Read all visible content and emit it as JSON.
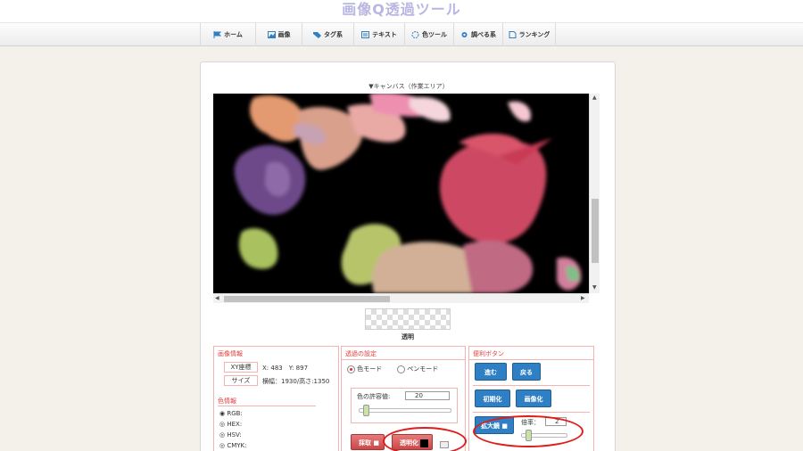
{
  "app": {
    "title": "画像Q透過ツール"
  },
  "nav": [
    {
      "label": "ホーム",
      "icon": "flag-icon"
    },
    {
      "label": "画像",
      "icon": "image-icon"
    },
    {
      "label": "タグ系",
      "icon": "tag-icon"
    },
    {
      "label": "テキスト",
      "icon": "text-icon"
    },
    {
      "label": "色ツール",
      "icon": "palette-icon"
    },
    {
      "label": "調べる系",
      "icon": "gear-icon"
    },
    {
      "label": "ランキング",
      "icon": "document-icon"
    }
  ],
  "canvas": {
    "title": "▼キャンバス（作業エリア）",
    "transparent_label": "透明"
  },
  "image_info": {
    "title": "画像情報",
    "xy_label": "XY座標",
    "xy_value": "X: 483　Y: 897",
    "size_label": "サイズ",
    "size_value": "横幅：1930/高さ:1350"
  },
  "color_info": {
    "title": "色情報",
    "options": [
      "RGB:",
      "HEX:",
      "HSV:",
      "CMYK:"
    ],
    "selected": "RGB:"
  },
  "transparency": {
    "title": "透過の設定",
    "mode_color": "色モード",
    "mode_pen": "ペンモード",
    "tolerance_label": "色の許容値:",
    "tolerance_value": "20",
    "tolerance_level": 0.05,
    "select_button": "採取",
    "transparent_button": "透明化"
  },
  "buttons": {
    "title": "便利ボタン",
    "forward": "進む",
    "back": "戻る",
    "reset": "初期化",
    "to_image": "画像化",
    "zoom": "拡大鏡",
    "zoom_rate_label": "倍率：",
    "zoom_rate_value": "2",
    "zoom_level": 0.1
  },
  "colors": {
    "accent_blue": "#2f7fc4",
    "accent_red": "#e04040",
    "highlight": "#e01b1b"
  }
}
